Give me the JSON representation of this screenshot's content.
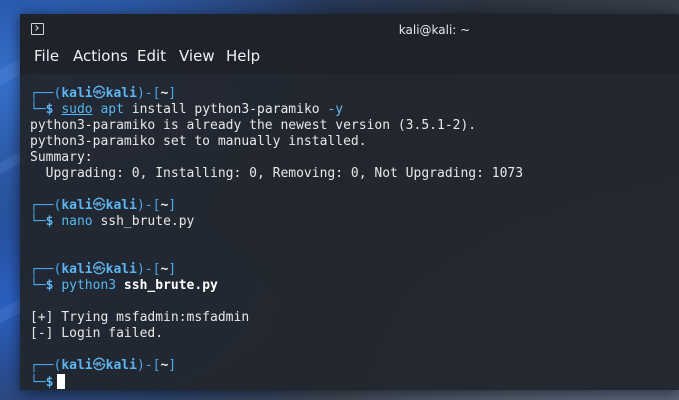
{
  "window": {
    "title": "kali@kali: ~"
  },
  "menu": [
    "File",
    "Actions",
    "Edit",
    "View",
    "Help"
  ],
  "prompt": {
    "user": "kali",
    "host": "kali",
    "dir": "~"
  },
  "session": {
    "cmd1": {
      "sudo": "sudo",
      "apt": "apt",
      "args": " install python3-paramiko",
      "flag": "-y"
    },
    "out1": [
      "python3-paramiko is already the newest version (3.5.1-2).",
      "python3-paramiko set to manually installed.",
      "Summary:",
      "  Upgrading: 0, Installing: 0, Removing: 0, Not Upgrading: 1073"
    ],
    "cmd2": {
      "kw": "nano",
      "args": " ssh_brute.py"
    },
    "cmd3": {
      "kw": "python3",
      "args": " ssh_brute.py"
    },
    "out3": [
      "[+] Trying msfadmin:msfadmin",
      "[-] Login failed."
    ]
  },
  "colors": {
    "prompt_blue": "#5cb6f2",
    "terminal_bg": "#22262e",
    "text": "#e8e8e8"
  }
}
